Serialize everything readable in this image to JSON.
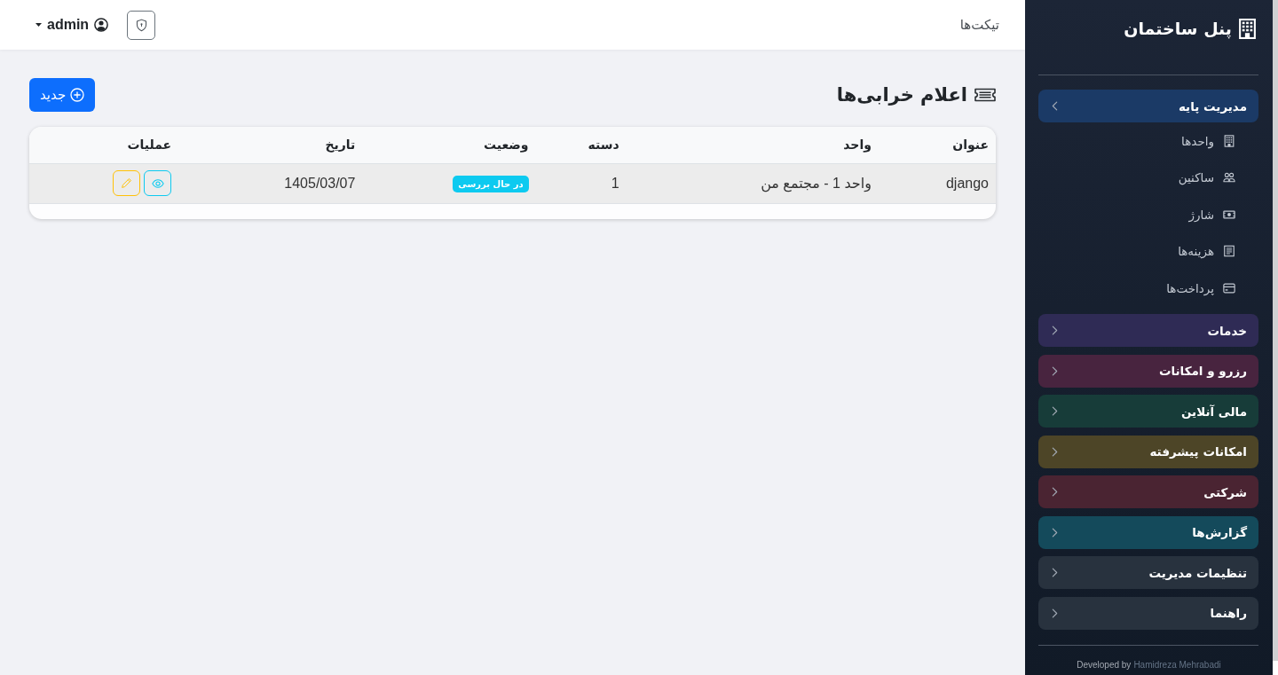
{
  "topbar": {
    "title": "تیکت‌ها",
    "user": {
      "name": "admin"
    }
  },
  "page": {
    "heading": "اعلام خرابی‌ها",
    "new_button": "جدید"
  },
  "table": {
    "columns": [
      "عنوان",
      "واحد",
      "دسته",
      "وضعیت",
      "تاریخ",
      "عملیات"
    ],
    "rows": [
      {
        "title": "django",
        "unit": "واحد 1 - مجتمع من",
        "category": "1",
        "status": {
          "label": "در حال بررسی",
          "color": "#0dcaf0"
        },
        "date": "1405/03/07",
        "highlighted": true,
        "actions": [
          {
            "kind": "view"
          },
          {
            "kind": "edit"
          }
        ]
      }
    ]
  },
  "sidebar": {
    "brand": "پنل ساختمان",
    "groups": [
      {
        "label": "مدیریت پایه",
        "color": "#1b3a66",
        "expanded": true,
        "children": [
          {
            "label": "واحدها"
          },
          {
            "label": "ساکنین"
          },
          {
            "label": "شارژ"
          },
          {
            "label": "هزینه‌ها"
          },
          {
            "label": "پرداخت‌ها"
          }
        ]
      },
      {
        "label": "خدمات",
        "color": "#2f2b55",
        "expanded": false
      },
      {
        "label": "رزرو و امکانات",
        "color": "#48243f",
        "expanded": false
      },
      {
        "label": "مالی آنلاین",
        "color": "#173c39",
        "expanded": false
      },
      {
        "label": "امکانات پیشرفته",
        "color": "#4d4527",
        "expanded": false
      },
      {
        "label": "شرکتی",
        "color": "#4a2432",
        "expanded": false
      },
      {
        "label": "گزارش‌ها",
        "color": "#144a5b",
        "expanded": false
      },
      {
        "label": "تنظیمات مدیریت",
        "color": "#28323e",
        "expanded": false
      },
      {
        "label": "راهنما",
        "color": "#28323e",
        "expanded": false
      }
    ],
    "footer": {
      "text": "Developed by",
      "link": "Hamidreza Mehrabadi"
    }
  }
}
